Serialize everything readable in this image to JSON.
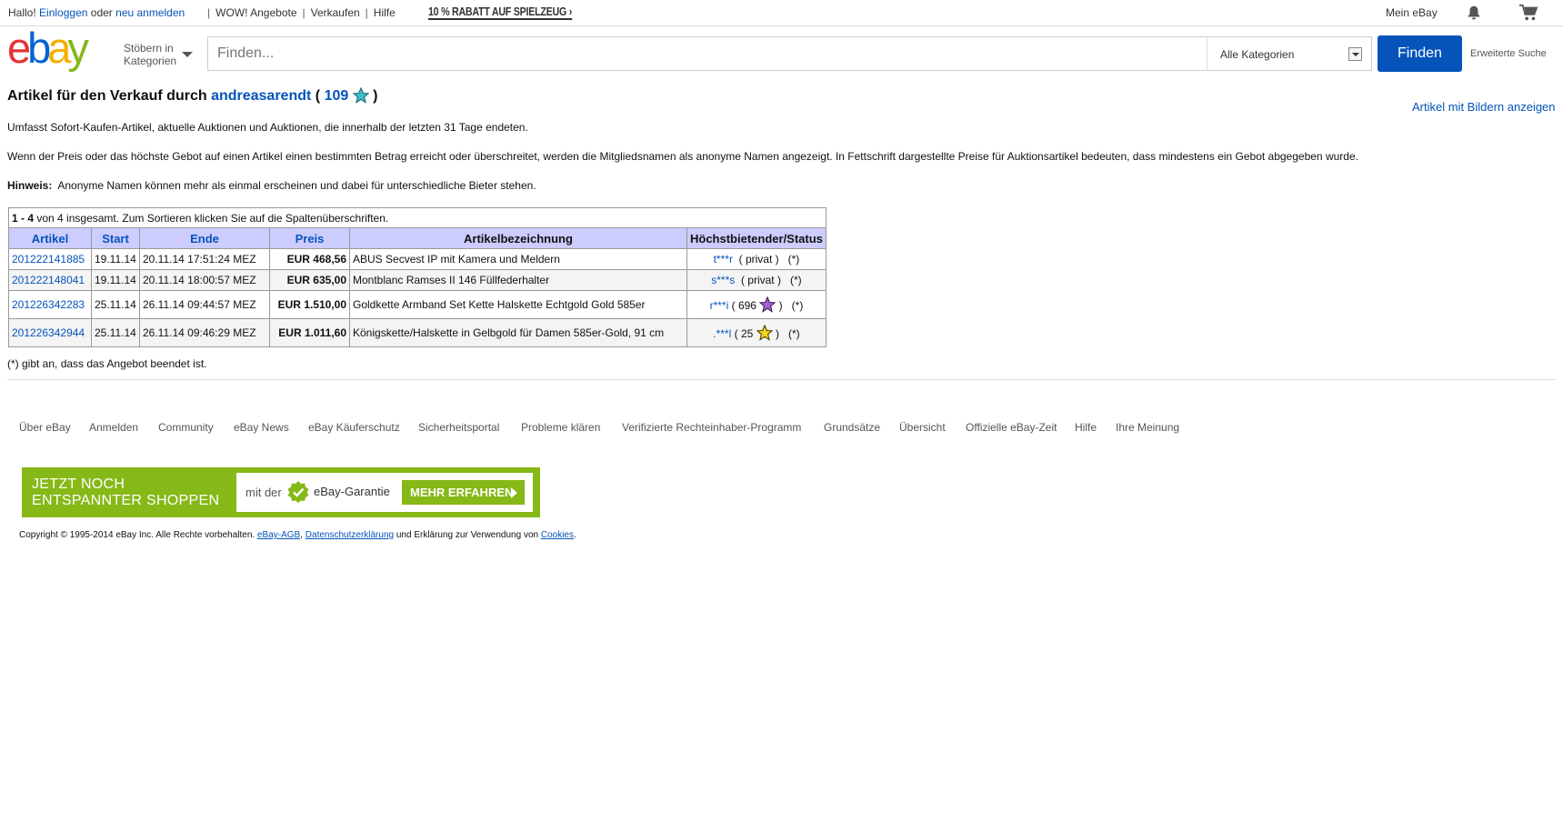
{
  "topbar": {
    "hello": "Hallo!",
    "login": "Einloggen",
    "or": "oder",
    "register": "neu anmelden",
    "deals": "WOW! Angebote",
    "sell": "Verkaufen",
    "help": "Hilfe",
    "promo": "10 % RABATT AUF SPIELZEUG",
    "my_ebay": "Mein eBay"
  },
  "header": {
    "browse_line1": "Stöbern in",
    "browse_line2": "Kategorien",
    "search_placeholder": "Finden...",
    "category": "Alle Kategorien",
    "find": "Finden",
    "advanced": "Erweiterte Suche"
  },
  "page": {
    "title_prefix": "Artikel für den Verkauf durch",
    "seller": "andreasarendt",
    "open_paren": "(",
    "feedback": "109",
    "close_paren": ")",
    "show_pictures": "Artikel mit Bildern anzeigen",
    "info1": "Umfasst Sofort-Kaufen-Artikel, aktuelle Auktionen und Auktionen, die innerhalb der letzten 31 Tage endeten.",
    "info2": "Wenn der Preis oder das höchste Gebot auf einen Artikel einen bestimmten Betrag erreicht oder überschreitet, werden die Mitgliedsnamen als anonyme Namen angezeigt. In Fettschrift dargestellte Preise für Auktionsartikel bedeuten, dass mindestens ein Gebot abgegeben wurde.",
    "hint_label": "Hinweis:",
    "hint_text": "Anonyme Namen können mehr als einmal erscheinen und dabei für unterschiedliche Bieter stehen."
  },
  "table": {
    "range": "1 - 4",
    "count_text": "von 4 insgesamt. Zum Sortieren klicken Sie auf die Spaltenüberschriften.",
    "headers": {
      "item": "Artikel",
      "start": "Start",
      "end": "Ende",
      "price": "Preis",
      "title": "Artikelbezeichnung",
      "bidder": "Höchstbietender/Status"
    },
    "rows": [
      {
        "item": "201222141885",
        "start": "19.11.14",
        "end": "20.11.14 17:51:24 MEZ",
        "price": "EUR 468,56",
        "title": "ABUS Secvest IP mit Kamera und Meldern",
        "bidder": "t***r",
        "bidder_info": "( privat )",
        "status": "(*)"
      },
      {
        "item": "201222148041",
        "start": "19.11.14",
        "end": "20.11.14 18:00:57 MEZ",
        "price": "EUR 635,00",
        "title": "Montblanc Ramses II 146 Füllfederhalter",
        "bidder": "s***s",
        "bidder_info": "( privat )",
        "status": "(*)"
      },
      {
        "item": "201226342283",
        "start": "25.11.14",
        "end": "26.11.14 09:44:57 MEZ",
        "price": "EUR 1.510,00",
        "title": "Goldkette Armband Set Kette Halskette Echtgold Gold 585er",
        "bidder": "r***i",
        "bidder_open": "(",
        "bidder_score": "696",
        "bidder_close": ")",
        "status": "(*)"
      },
      {
        "item": "201226342944",
        "start": "25.11.14",
        "end": "26.11.14 09:46:29 MEZ",
        "price": "EUR 1.011,60",
        "title": "Königskette/Halskette in Gelbgold für Damen 585er-Gold, 91 cm",
        "bidder": ".***l",
        "bidder_open": "(",
        "bidder_score": "25",
        "bidder_close": ")",
        "status": "(*)"
      }
    ],
    "note": "(*) gibt an, dass das Angebot beendet ist."
  },
  "footer": {
    "links": [
      "Über eBay",
      "Anmelden",
      "Community",
      "eBay News",
      "eBay Käuferschutz",
      "Sicherheitsportal",
      "Probleme klären",
      "Verifizierte Rechteinhaber-Programm",
      "Grundsätze",
      "Übersicht",
      "Offizielle eBay-Zeit",
      "Hilfe",
      "Ihre Meinung"
    ],
    "banner_line1": "JETZT NOCH",
    "banner_line2": "ENTSPANNTER SHOPPEN",
    "banner_mit": "mit der",
    "banner_guarantee": "eBay-Garantie",
    "banner_more": "MEHR ERFAHREN",
    "copyright": "Copyright © 1995-2014 eBay Inc. Alle Rechte vorbehalten.",
    "agb": "eBay-AGB",
    "comma": ",",
    "privacy": "Datenschutzerklärung",
    "and_text": "und Erklärung zur Verwendung von",
    "cookies": "Cookies",
    "period": "."
  },
  "colors": {
    "link": "#0654ba",
    "header_bg": "#ccccff",
    "banner_green": "#86b817",
    "find_button": "#0654ba",
    "logo_e": "#e53238",
    "logo_b": "#0064d2",
    "logo_a": "#f5af02",
    "logo_y": "#86b817"
  },
  "icons": [
    "notification-bell-icon",
    "shopping-cart-icon",
    "chevron-right-icon",
    "caret-down-icon",
    "turquoise-star-icon",
    "purple-star-icon",
    "yellow-star-icon",
    "green-check-icon"
  ]
}
